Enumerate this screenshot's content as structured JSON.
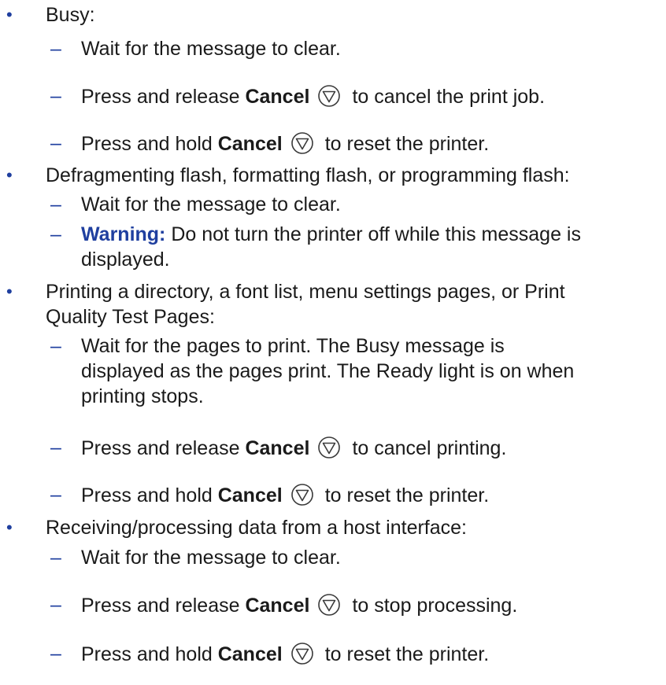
{
  "markers": {
    "bullet": "•",
    "dash": "–"
  },
  "sections": [
    {
      "label": "Busy:",
      "steps": [
        {
          "text": "Wait for the message to clear."
        },
        {
          "pre": "Press and release ",
          "bold": "Cancel",
          "post": "to cancel the print job."
        },
        {
          "pre": "Press and hold ",
          "bold": "Cancel",
          "post": "to reset the printer."
        }
      ]
    },
    {
      "label": "Defragmenting flash, formatting flash, or programming flash:",
      "steps": [
        {
          "text": "Wait for the message to clear."
        },
        {
          "warning_label": "Warning:",
          "warning_text_line1": " Do not turn the printer off while this message is",
          "warning_text_line2": "displayed."
        }
      ]
    },
    {
      "label_line1": "Printing a directory, a font list, menu settings pages, or Print",
      "label_line2": "Quality Test Pages:",
      "steps": [
        {
          "text_line1": "Wait for the pages to print. The Busy message is",
          "text_line2": "displayed as the pages print. The Ready light is on when",
          "text_line3": "printing stops."
        },
        {
          "pre": "Press and release ",
          "bold": "Cancel",
          "post": "to cancel printing."
        },
        {
          "pre": "Press and hold ",
          "bold": "Cancel",
          "post": "to reset the printer."
        }
      ]
    },
    {
      "label": "Receiving/processing data from a host interface:",
      "steps": [
        {
          "text": "Wait for the message to clear."
        },
        {
          "pre": "Press and release ",
          "bold": "Cancel",
          "post": "to stop processing."
        },
        {
          "pre": "Press and hold ",
          "bold": "Cancel",
          "post": "to reset the printer."
        }
      ]
    }
  ],
  "icons": {
    "cancel_button": "cancel-button-icon"
  },
  "colors": {
    "accent": "#1f3f9f",
    "text": "#1a1a1a"
  }
}
